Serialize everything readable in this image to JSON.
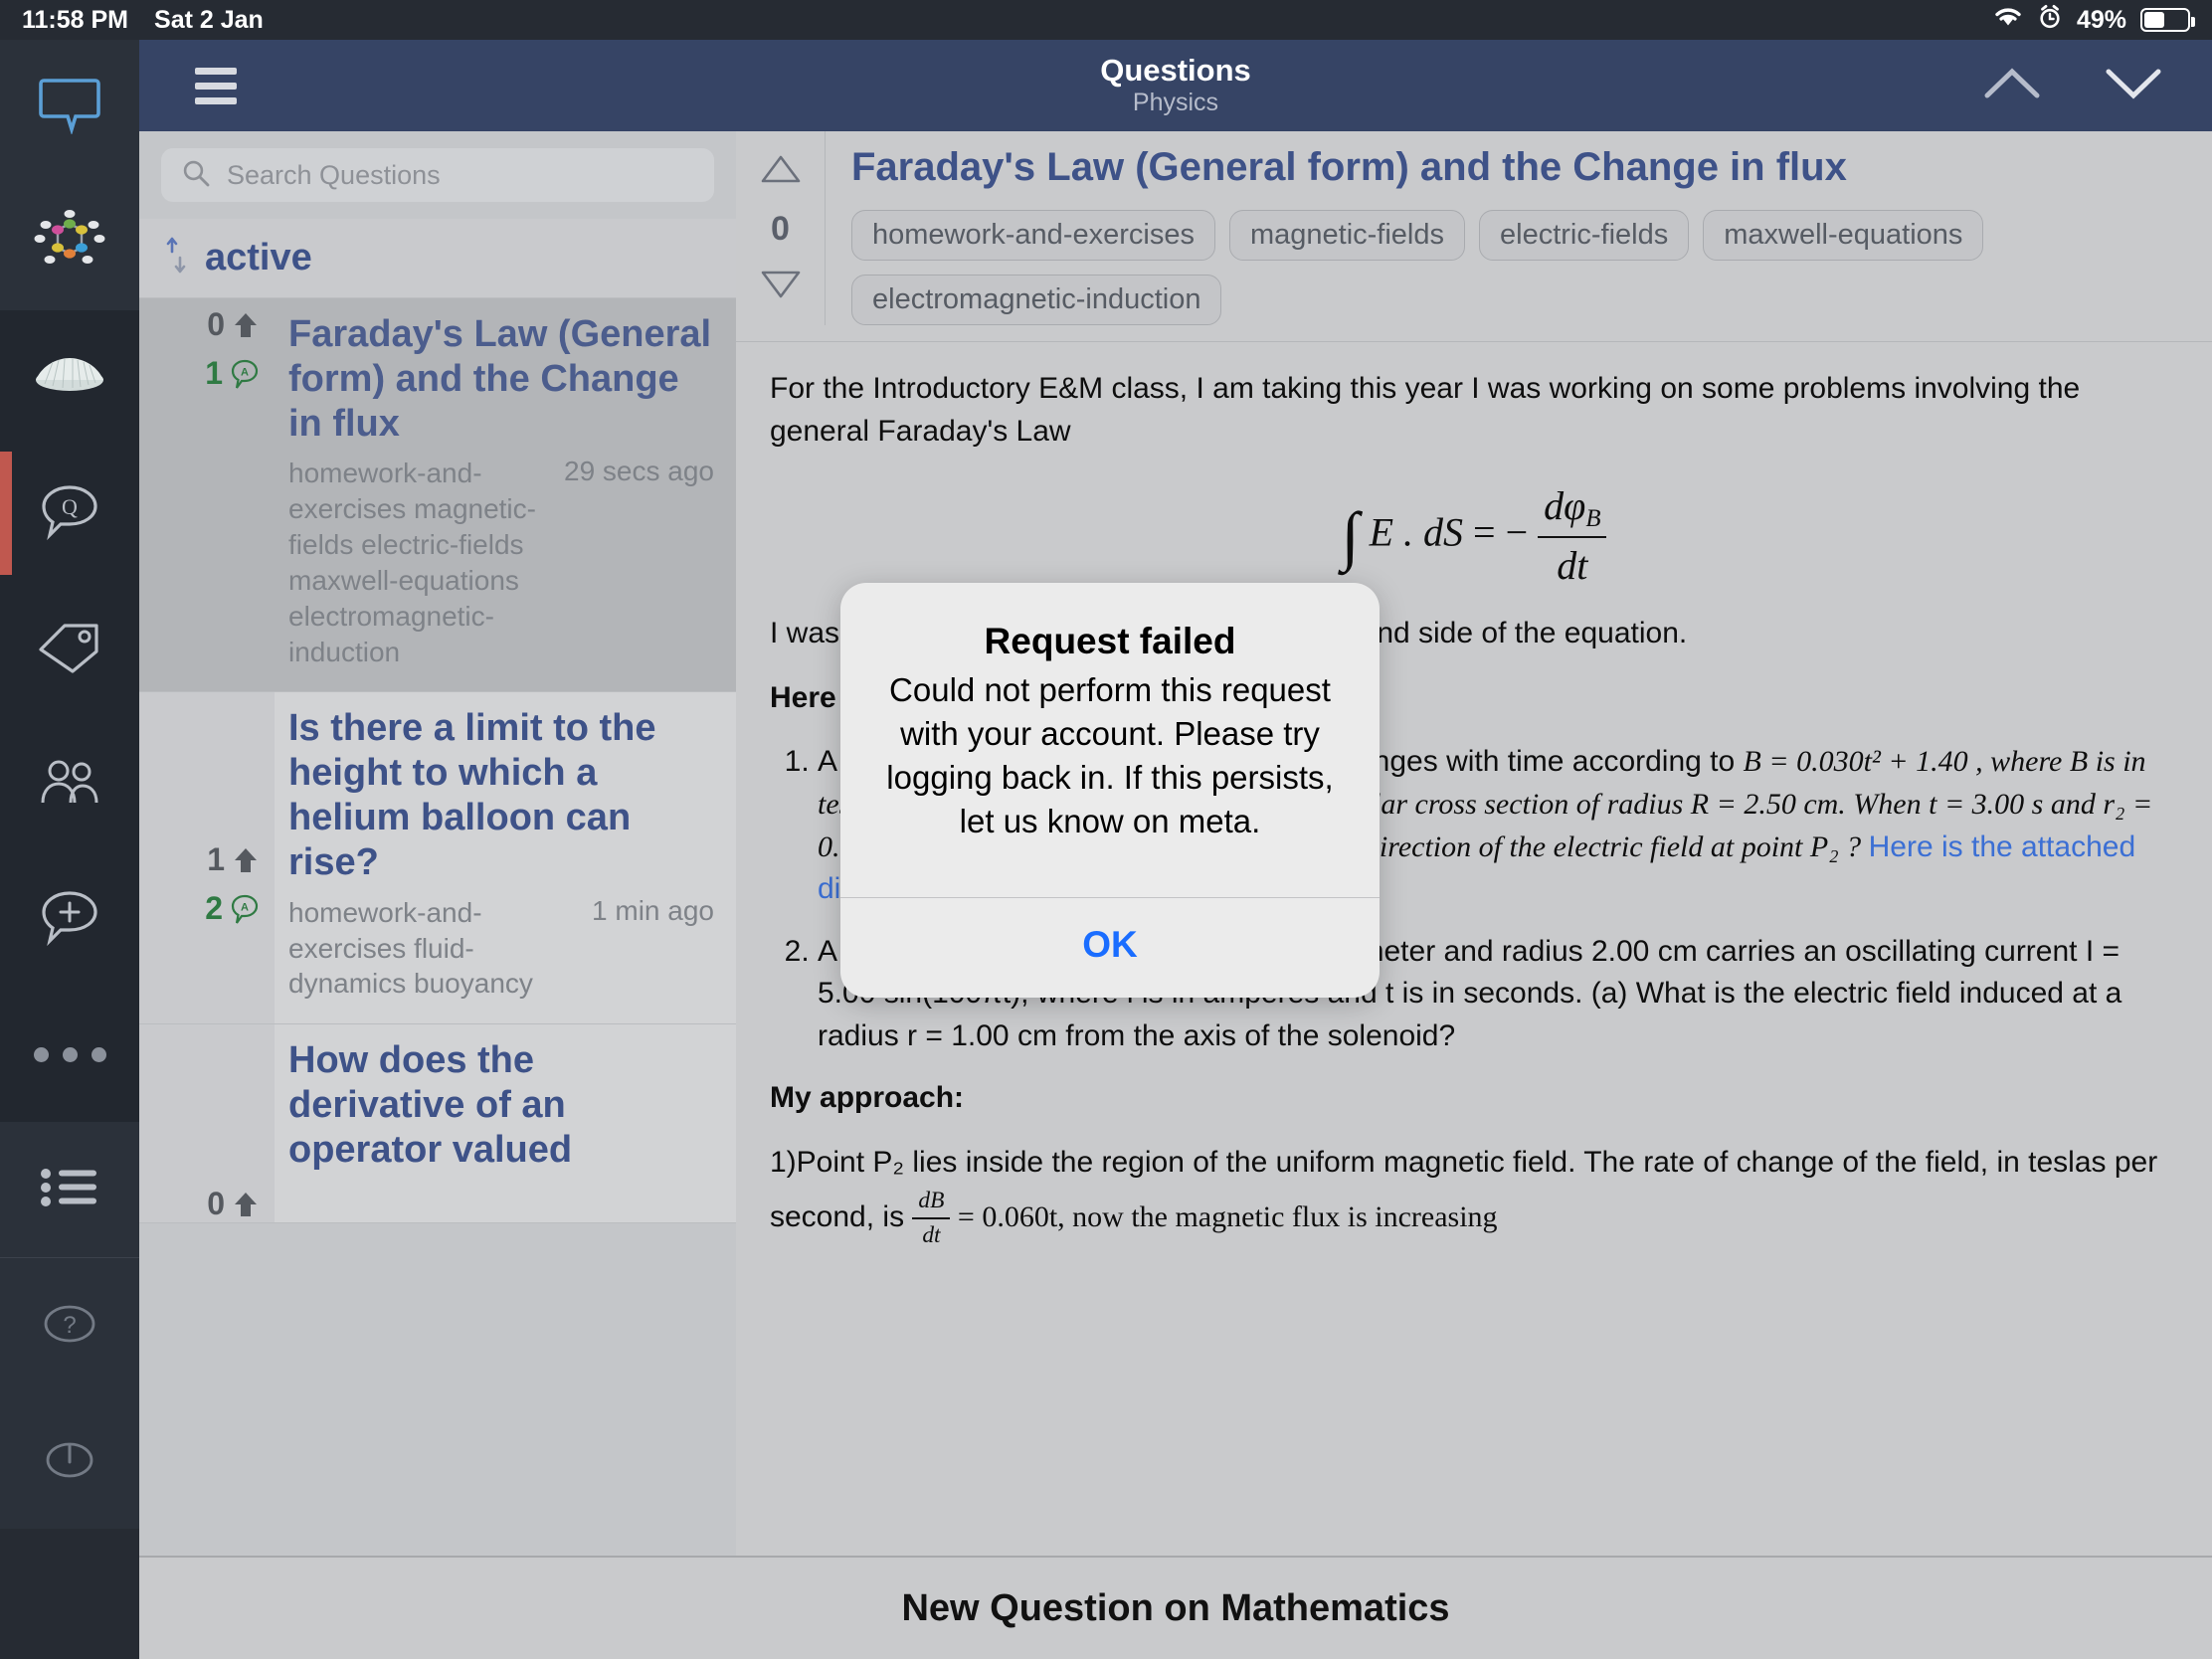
{
  "status_bar": {
    "time": "11:58 PM",
    "date": "Sat 2 Jan",
    "battery_percent": "49%",
    "icons": [
      "wifi-icon",
      "alarm-clock-icon",
      "battery-icon"
    ]
  },
  "sidebar": {
    "items": [
      {
        "name": "chat-bubble-icon",
        "active": false
      },
      {
        "name": "network-nodes-icon",
        "active": false
      },
      {
        "name": "cloud-icon",
        "active": false
      },
      {
        "name": "questions-icon",
        "active": true
      },
      {
        "name": "tags-icon",
        "active": false
      },
      {
        "name": "users-icon",
        "active": false
      },
      {
        "name": "ask-question-icon",
        "active": false
      },
      {
        "name": "more-icon",
        "active": false
      },
      {
        "name": "list-icon",
        "active": false
      },
      {
        "name": "help-icon",
        "active": false
      },
      {
        "name": "power-icon",
        "active": false
      }
    ]
  },
  "navbar": {
    "menu_label": "menu",
    "title": "Questions",
    "subtitle": "Physics",
    "up_label": "previous",
    "down_label": "next"
  },
  "search": {
    "placeholder": "Search Questions",
    "value": ""
  },
  "sort": {
    "label": "active"
  },
  "question_list": [
    {
      "title": "Faraday's Law (General form) and the Change in flux",
      "votes": "0",
      "answers": "1",
      "tags": "homework-and-exercises magnetic-fields electric-fields maxwell-equations electromagnetic-induction",
      "time": "29 secs ago",
      "selected": true
    },
    {
      "title": "Is there a limit to the height to which a helium balloon can rise?",
      "votes": "1",
      "answers": "2",
      "tags": "homework-and-exercises  fluid-dynamics buoyancy",
      "time": "1 min ago",
      "selected": false
    },
    {
      "title": "How does the derivative of an operator valued",
      "votes": "0",
      "answers": "",
      "tags": "",
      "time": "",
      "selected": false
    }
  ],
  "question_detail": {
    "vote_count": "0",
    "upvote_label": "upvote",
    "downvote_label": "downvote",
    "title": "Faraday's Law (General form) and the Change in flux",
    "tags": [
      "homework-and-exercises",
      "magnetic-fields",
      "electric-fields",
      "maxwell-equations",
      "electromagnetic-induction"
    ],
    "intro": "For the Introductory E&M class, I am taking this year I was working on some problems involving the general Faraday's Law",
    "equation": {
      "lhs": "E . dS",
      "relation": "= −",
      "rhs_numerator": "dφ",
      "rhs_numerator_sub": "B",
      "rhs_denominator": "dt"
    },
    "paragraph_2": "I was trying to interpret the flux on the right-hand side of the equation.",
    "heading_here": "Here",
    "problems": [
      {
        "number": "1.",
        "text_parts": [
          "A uniform magnetic field into the page changes with time according to ",
          "B = 0.030t² + 1.40 , where B is in teslas and t is in seconds. The field has a circular cross section of radius R = 2.50 cm. When t = 3.00 s and r₂ = 0.02 m, what is (a) the magnitude and (b) the direction of the electric field at point P₂ ? "
        ],
        "link_text": "Here is the attached diagram",
        "trailing": "]1"
      },
      {
        "number": "2.",
        "text_parts": [
          "A long solenoid with 1.00 × 10³ turns per meter and radius 2.00 cm carries an oscillating current I = 5.00 sin(100πt), where i is in amperes and t is in seconds. (a) What is the electric field induced at a radius r = 1.00 cm from the axis of the solenoid?"
        ]
      }
    ],
    "approach_heading": "My approach:",
    "approach_text_1": "1)Point P₂ lies inside the region of the uniform magnetic field. The rate of change of the field, in teslas per second, is ",
    "approach_fraction_num": "dB",
    "approach_fraction_den": "dt",
    "approach_text_2": " = 0.060t, now the magnetic flux is increasing"
  },
  "alert": {
    "title": "Request failed",
    "message": "Could not perform this request with your account. Please try logging back in. If this persists, let us know on meta.",
    "ok_label": "OK",
    "accent_color": "#1a6dff"
  },
  "bottom_bar": {
    "label": "New Question on Mathematics"
  },
  "colors": {
    "navbar": "#364465",
    "rail": "#262b33",
    "active_marker": "#c0584f",
    "link": "#3e5288",
    "answer_green": "#2f7a43",
    "page_bg": "#c9cacc"
  }
}
